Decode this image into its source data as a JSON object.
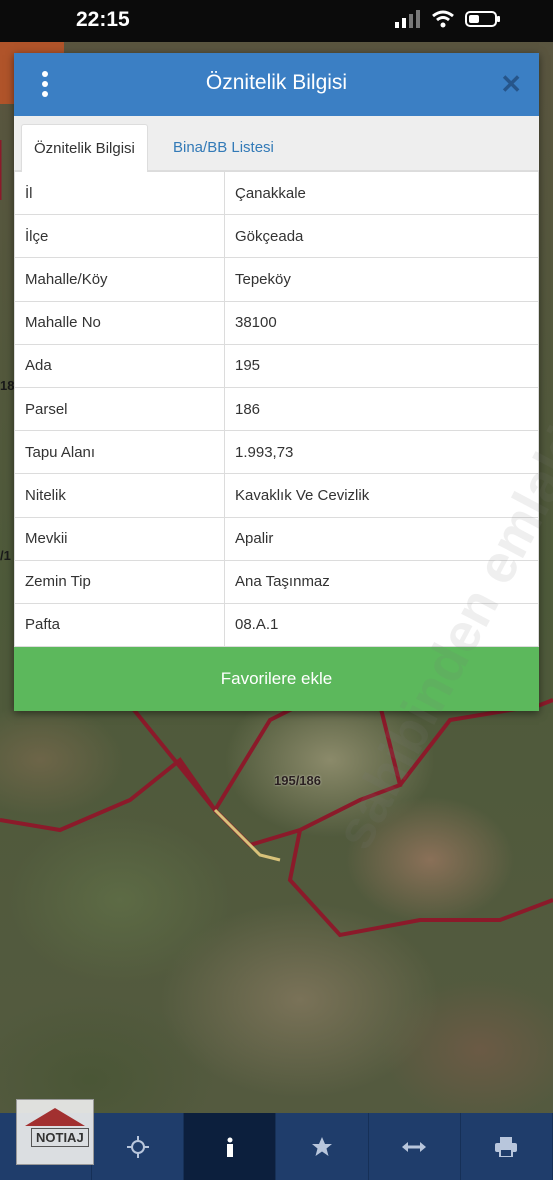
{
  "status_bar": {
    "time": "22:15"
  },
  "dialog": {
    "title": "Öznitelik Bilgisi",
    "tabs": [
      {
        "label": "Öznitelik Bilgisi",
        "active": true
      },
      {
        "label": "Bina/BB Listesi",
        "active": false
      }
    ],
    "rows": [
      {
        "key": "İl",
        "value": "Çanakkale"
      },
      {
        "key": "İlçe",
        "value": "Gökçeada"
      },
      {
        "key": "Mahalle/Köy",
        "value": "Tepeköy"
      },
      {
        "key": "Mahalle No",
        "value": "38100"
      },
      {
        "key": "Ada",
        "value": "195"
      },
      {
        "key": "Parsel",
        "value": "186"
      },
      {
        "key": "Tapu Alanı",
        "value": "1.993,73"
      },
      {
        "key": "Nitelik",
        "value": "Kavaklık Ve Cevizlik"
      },
      {
        "key": "Mevkii",
        "value": "Apalir"
      },
      {
        "key": "Zemin Tip",
        "value": "Ana Taşınmaz"
      },
      {
        "key": "Pafta",
        "value": "08.A.1"
      }
    ],
    "favorite_button": "Favorilere ekle"
  },
  "map": {
    "parcel_label": "195/186",
    "edge_label_1": "18",
    "edge_label_2": "/1"
  },
  "watermark": "sahibinden emlakjet.com",
  "logo_text": "NOTIAJ",
  "toolbar": {
    "items": [
      {
        "icon": "location-crosshair-icon",
        "active": false
      },
      {
        "icon": "info-icon",
        "active": true
      },
      {
        "icon": "star-icon",
        "active": false
      },
      {
        "icon": "measure-arrows-icon",
        "active": false
      },
      {
        "icon": "print-icon",
        "active": false
      }
    ]
  },
  "colors": {
    "header": "#3b7fc4",
    "favorite_button": "#5cb85c",
    "toolbar": "#1f3d6b",
    "toolbar_active": "#0c1f3d",
    "parcel_border": "#8b1a2a"
  }
}
